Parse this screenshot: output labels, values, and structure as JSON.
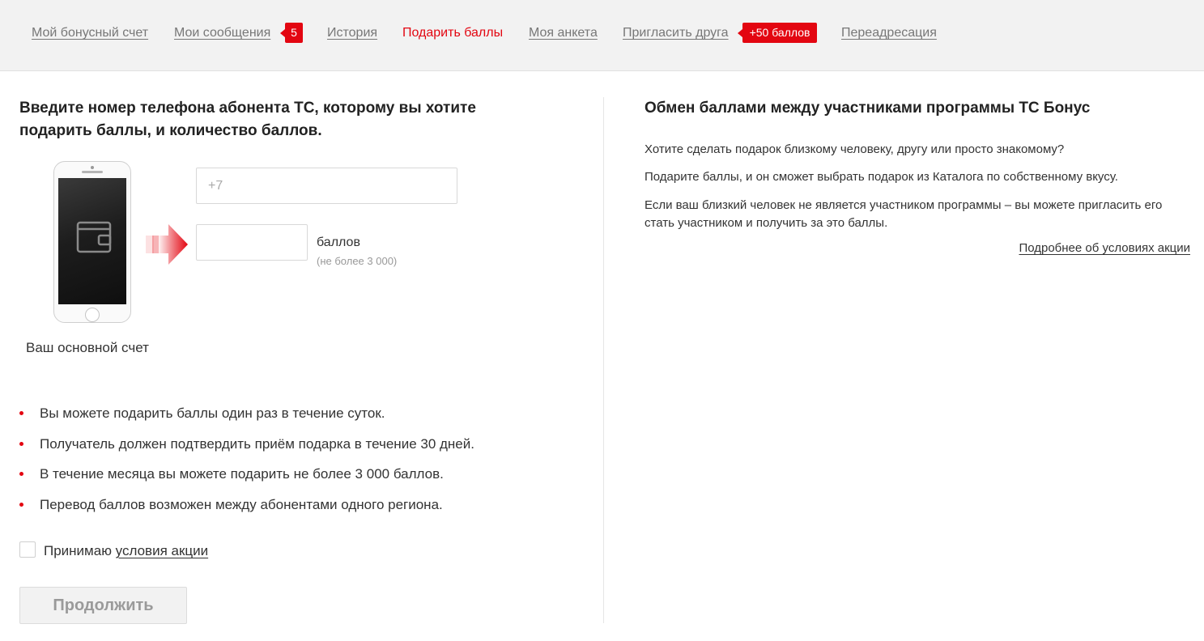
{
  "nav": {
    "items": [
      {
        "label": "Мой бонусный счет"
      },
      {
        "label": "Мои сообщения"
      },
      {
        "label": "История"
      },
      {
        "label": "Подарить баллы"
      },
      {
        "label": "Моя анкета"
      },
      {
        "label": "Пригласить друга"
      },
      {
        "label": "Переадресация"
      }
    ],
    "messages_badge": "5",
    "invite_badge": "+50 баллов",
    "active_color": "#e30611"
  },
  "form": {
    "title": "Введите номер телефона абонента  ТС, которому вы хотите подарить баллы, и количество баллов.",
    "phone_caption": "Ваш основной счет",
    "phone_placeholder": "+7",
    "points_value": "",
    "points_unit": "баллов",
    "points_hint": "(не более 3 000)",
    "rules": [
      "Вы можете подарить баллы один раз в течение суток.",
      "Получатель должен подтвердить приём подарка в течение 30 дней.",
      "В течение месяца вы можете подарить не более 3 000 баллов.",
      "Перевод баллов возможен между абонентами одного региона."
    ],
    "accept_prefix": "Принимаю ",
    "accept_link": "условия акции",
    "continue_label": "Продолжить"
  },
  "info": {
    "title": "Обмен баллами между участниками программы   ТС Бонус",
    "paragraphs": [
      "Хотите сделать подарок близкому человеку, другу или просто знакомому?",
      "Подарите баллы, и он сможет выбрать подарок из Каталога по собственному вкусу.",
      "Если ваш близкий человек не является участником программы – вы можете пригласить его стать участником и получить за это баллы."
    ],
    "more_link": "Подробнее об условиях акции"
  }
}
